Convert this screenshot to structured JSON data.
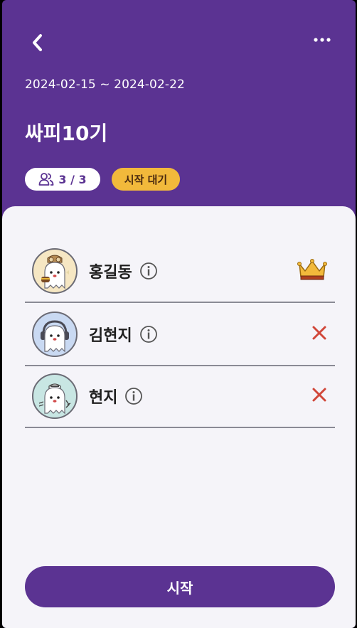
{
  "header": {
    "back_icon": "chevron-left-icon",
    "more_icon": "more-horizontal-icon",
    "date_range": "2024-02-15 ~ 2024-02-22",
    "room_title": "싸피10기",
    "participants": "3 / 3",
    "participants_icon": "users-icon",
    "status": "시작 대기"
  },
  "members": [
    {
      "name": "홍길동",
      "role_icon": "crown-icon",
      "avatar_bg": "#f6e7c3"
    },
    {
      "name": "김현지",
      "role_icon": "close-icon",
      "avatar_bg": "#c9d9f2"
    },
    {
      "name": "현지",
      "role_icon": "close-icon",
      "avatar_bg": "#c8e6e3"
    }
  ],
  "start_button": {
    "label": "시작"
  },
  "colors": {
    "primary": "#5b3392",
    "status_badge": "#f2b93b",
    "remove": "#d1473a",
    "crown": "#f2b93b"
  }
}
